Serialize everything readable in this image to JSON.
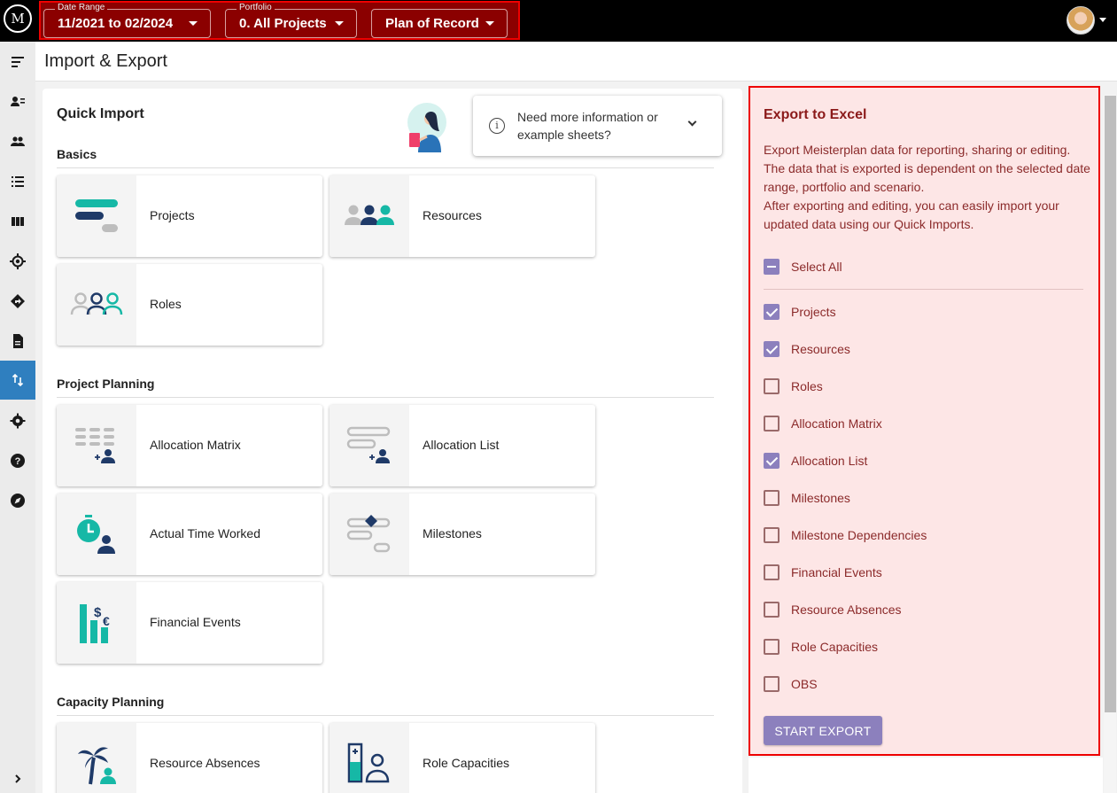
{
  "app": {
    "logo_text": "M"
  },
  "filters": {
    "date_range": {
      "label": "Date Range",
      "value": "11/2021 to 02/2024"
    },
    "portfolio": {
      "label": "Portfolio",
      "value": "0. All Projects"
    },
    "scenario": {
      "value": "Plan of Record"
    }
  },
  "page": {
    "title": "Import & Export"
  },
  "sidebar": {
    "items": [
      {
        "icon": "menu-icon"
      },
      {
        "icon": "resource-list-icon"
      },
      {
        "icon": "people-icon"
      },
      {
        "icon": "list-icon"
      },
      {
        "icon": "columns-icon"
      },
      {
        "icon": "target-icon"
      },
      {
        "icon": "directions-icon"
      },
      {
        "icon": "document-icon"
      },
      {
        "icon": "import-export-icon",
        "active": true
      },
      {
        "icon": "gear-icon"
      },
      {
        "icon": "help-icon"
      },
      {
        "icon": "compass-icon"
      },
      {
        "icon": "chevron-right-icon"
      }
    ]
  },
  "quick_import": {
    "title": "Quick Import",
    "info": {
      "text": "Need more information or example sheets?"
    },
    "sections": {
      "basics": "Basics",
      "project_planning": "Project Planning",
      "capacity_planning": "Capacity Planning"
    },
    "cards": {
      "projects": "Projects",
      "resources": "Resources",
      "roles": "Roles",
      "allocation_matrix": "Allocation Matrix",
      "allocation_list": "Allocation List",
      "actual_time_worked": "Actual Time Worked",
      "milestones": "Milestones",
      "financial_events": "Financial Events",
      "resource_absences": "Resource Absences",
      "role_capacities": "Role Capacities"
    }
  },
  "export": {
    "title": "Export to Excel",
    "description_1": "Export Meisterplan data for reporting, sharing or editing. The data that is exported is dependent on the selected date range, portfolio and scenario.",
    "description_2": "After exporting and editing, you can easily import your updated data using our Quick Imports.",
    "select_all": "Select All",
    "items": [
      {
        "label": "Projects",
        "checked": true
      },
      {
        "label": "Resources",
        "checked": true
      },
      {
        "label": "Roles",
        "checked": false
      },
      {
        "label": "Allocation Matrix",
        "checked": false
      },
      {
        "label": "Allocation List",
        "checked": true
      },
      {
        "label": "Milestones",
        "checked": false
      },
      {
        "label": "Milestone Dependencies",
        "checked": false
      },
      {
        "label": "Financial Events",
        "checked": false
      },
      {
        "label": "Resource Absences",
        "checked": false
      },
      {
        "label": "Role Capacities",
        "checked": false
      },
      {
        "label": "OBS",
        "checked": false
      }
    ],
    "button": "START EXPORT"
  },
  "colors": {
    "accent": "#8c80bd",
    "teal": "#16b8a6",
    "navy": "#1f3a68",
    "highlight": "#e00000"
  }
}
